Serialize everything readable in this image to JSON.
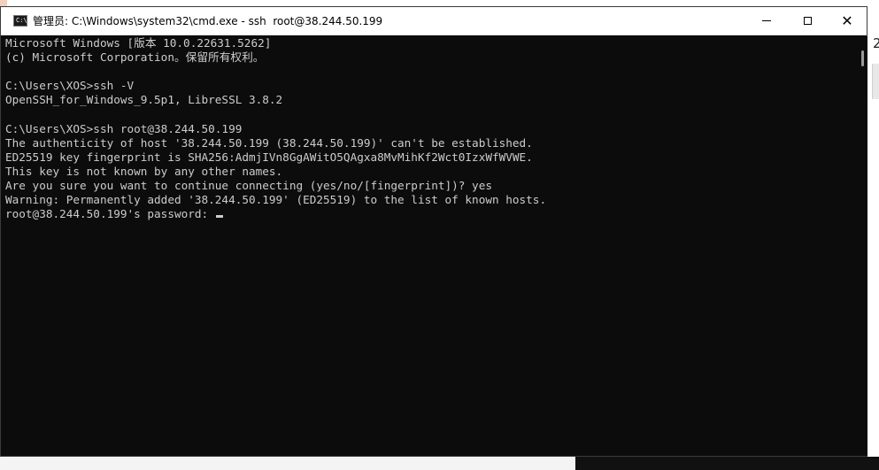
{
  "window": {
    "title": "管理员: C:\\Windows\\system32\\cmd.exe - ssh  root@38.244.50.199",
    "icon": "cmd-icon",
    "icon_text": "C:\\",
    "controls": {
      "minimize": "minimize-icon",
      "maximize": "maximize-icon",
      "close": "close-icon",
      "close_glyph": "✕"
    }
  },
  "console": {
    "lines": [
      "Microsoft Windows [版本 10.0.22631.5262]",
      "(c) Microsoft Corporation。保留所有权利。",
      "",
      "C:\\Users\\XOS>ssh -V",
      "OpenSSH_for_Windows_9.5p1, LibreSSL 3.8.2",
      "",
      "C:\\Users\\XOS>ssh root@38.244.50.199",
      "The authenticity of host '38.244.50.199 (38.244.50.199)' can't be established.",
      "ED25519 key fingerprint is SHA256:AdmjIVn8GgAWitO5QAgxa8MvMihKf2Wct0IzxWfWVWE.",
      "This key is not known by any other names.",
      "Are you sure you want to continue connecting (yes/no/[fingerprint])? yes",
      "Warning: Permanently added '38.244.50.199' (ED25519) to the list of known hosts.",
      "root@38.244.50.199's password: "
    ],
    "text_color": "#cccccc",
    "background": "#0c0c0c"
  },
  "background": {
    "right_text": "2"
  }
}
